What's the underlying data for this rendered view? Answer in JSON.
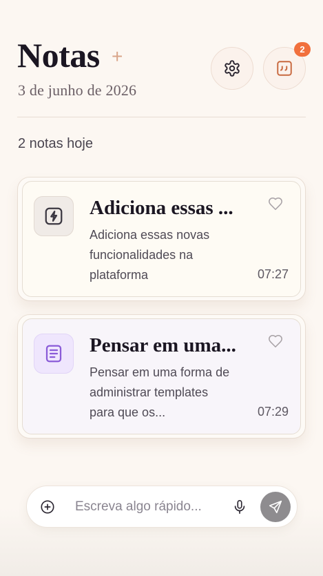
{
  "header": {
    "title": "Notas",
    "title_plus": "+",
    "date": "3 de junho de 2026",
    "notification_count": "2"
  },
  "summary": {
    "count_text": "2 notas hoje"
  },
  "notes": [
    {
      "title": "Adiciona essas ...",
      "body": "Adiciona essas novas funcionalidades na plataforma",
      "time": "07:27",
      "icon": "lightning-icon",
      "accent": "#4a4550"
    },
    {
      "title": "Pensar em uma...",
      "body": "Pensar em uma forma de administrar templates para que os...",
      "time": "07:29",
      "icon": "document-icon",
      "accent": "#8a5bd8"
    }
  ],
  "quick_input": {
    "placeholder": "Escreva algo rápido...",
    "value": ""
  },
  "colors": {
    "background": "#fcf7f2",
    "badge": "#f1703d",
    "title_plus": "#d9a58a",
    "quotes_icon": "#c8693f",
    "send_button": "#8e8c8f"
  }
}
